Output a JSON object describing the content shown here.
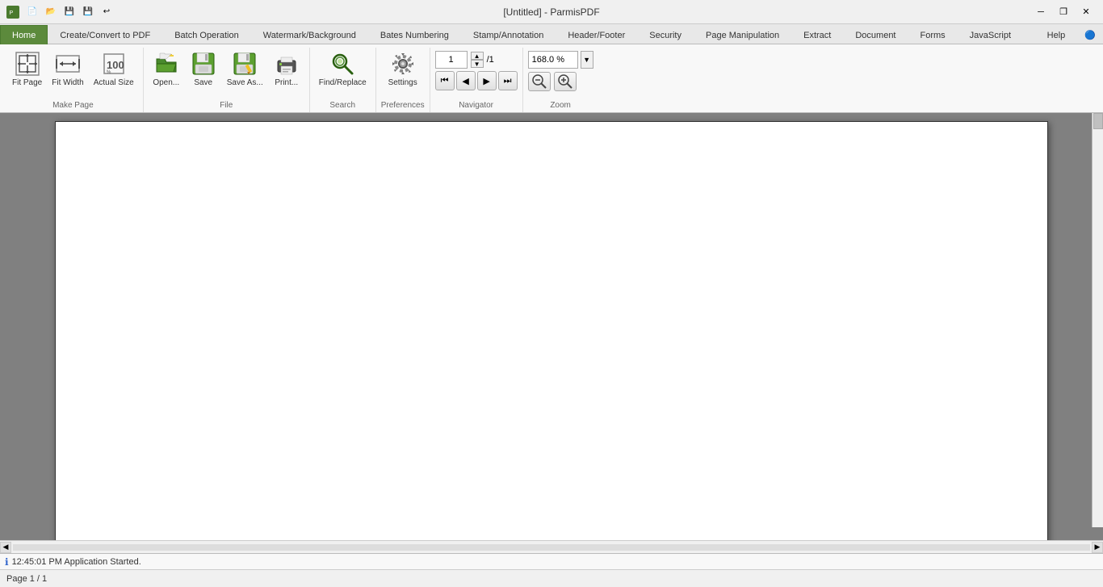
{
  "titleBar": {
    "title": "[Untitled] - ParmisPDF",
    "appIcon": "pdf-icon",
    "tbButtons": [
      "new",
      "open",
      "save",
      "save-as",
      "undo"
    ],
    "winControls": [
      "minimize",
      "restore",
      "close"
    ]
  },
  "ribbon": {
    "tabs": [
      {
        "id": "home",
        "label": "Home",
        "active": true,
        "isGreen": true
      },
      {
        "id": "create",
        "label": "Create/Convert to PDF",
        "active": false
      },
      {
        "id": "batch",
        "label": "Batch Operation",
        "active": false
      },
      {
        "id": "watermark",
        "label": "Watermark/Background",
        "active": false
      },
      {
        "id": "bates",
        "label": "Bates Numbering",
        "active": false
      },
      {
        "id": "stamp",
        "label": "Stamp/Annotation",
        "active": false
      },
      {
        "id": "header",
        "label": "Header/Footer",
        "active": false
      },
      {
        "id": "security",
        "label": "Security",
        "active": false
      },
      {
        "id": "page-manip",
        "label": "Page Manipulation",
        "active": false
      },
      {
        "id": "extract",
        "label": "Extract",
        "active": false
      },
      {
        "id": "document",
        "label": "Document",
        "active": false
      },
      {
        "id": "forms",
        "label": "Forms",
        "active": false
      },
      {
        "id": "javascript",
        "label": "JavaScript",
        "active": false
      },
      {
        "id": "help",
        "label": "Help",
        "active": false
      }
    ],
    "groups": {
      "makePage": {
        "label": "Make Page",
        "buttons": [
          {
            "id": "fit-page",
            "label": "Fit Page"
          },
          {
            "id": "fit-width",
            "label": "Fit Width"
          },
          {
            "id": "actual-size",
            "label": "Actual Size"
          }
        ]
      },
      "file": {
        "label": "File",
        "buttons": [
          {
            "id": "open",
            "label": "Open..."
          },
          {
            "id": "save",
            "label": "Save"
          },
          {
            "id": "save-as",
            "label": "Save As..."
          },
          {
            "id": "print",
            "label": "Print..."
          }
        ]
      },
      "search": {
        "label": "Search",
        "buttons": [
          {
            "id": "find-replace",
            "label": "Find/Replace"
          }
        ]
      },
      "preferences": {
        "label": "Preferences",
        "buttons": [
          {
            "id": "settings",
            "label": "Settings"
          }
        ]
      },
      "navigator": {
        "label": "Navigator",
        "pageValue": "1",
        "totalPages": "/1",
        "navButtons": [
          "first",
          "prev",
          "next",
          "last"
        ]
      },
      "zoom": {
        "label": "Zoom",
        "zoomValue": "168.0 %",
        "zoomIn": "zoom-in",
        "zoomOut": "zoom-out"
      }
    }
  },
  "statusBar": {
    "icon": "ℹ",
    "message": "12:45:01 PM Application Started."
  },
  "bottomBar": {
    "pageInfo": "Page 1 / 1"
  }
}
